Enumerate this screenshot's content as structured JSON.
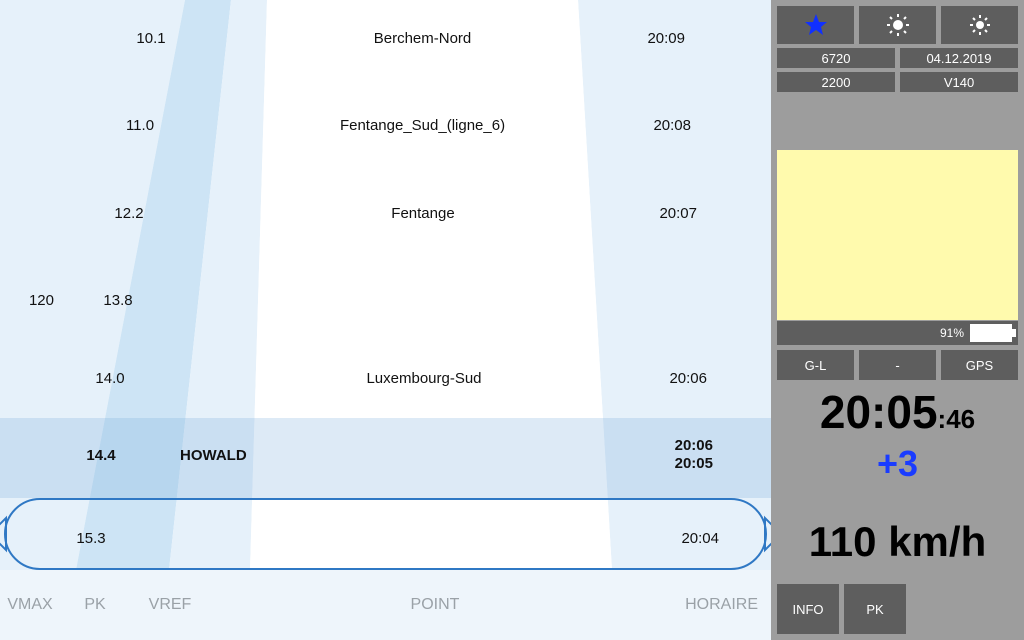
{
  "columns": {
    "vmax": "VMAX",
    "pk": "PK",
    "vref": "VREF",
    "point": "POINT",
    "horaire": "HORAIRE"
  },
  "stations": [
    {
      "pk": "10.1",
      "point": "Berchem-Nord",
      "time1": "20:09",
      "time2": "",
      "vmax": ""
    },
    {
      "pk": "11.0",
      "point": "Fentange_Sud_(ligne_6)",
      "time1": "20:08",
      "time2": "",
      "vmax": ""
    },
    {
      "pk": "12.2",
      "point": "Fentange",
      "time1": "20:07",
      "time2": "",
      "vmax": ""
    },
    {
      "pk": "13.8",
      "point": "",
      "time1": "",
      "time2": "",
      "vmax": "120"
    },
    {
      "pk": "14.0",
      "point": "Luxembourg-Sud",
      "time1": "20:06",
      "time2": "",
      "vmax": ""
    },
    {
      "pk": "14.4",
      "point": "HOWALD",
      "time1": "20:06",
      "time2": "20:05",
      "vmax": "",
      "current": true
    },
    {
      "pk": "15.3",
      "point": "",
      "time1": "20:04",
      "time2": "",
      "vmax": ""
    }
  ],
  "side": {
    "train_id": "6720",
    "date": "04.12.2019",
    "code": "2200",
    "v": "V140",
    "battery": "91%",
    "status": {
      "left": "G-L",
      "mid": "-",
      "right": "GPS"
    },
    "time_main": "20:05",
    "time_sec": ":46",
    "delay": "+3",
    "speed": "110 km/h",
    "btn_info": "INFO",
    "btn_pk": "PK"
  }
}
